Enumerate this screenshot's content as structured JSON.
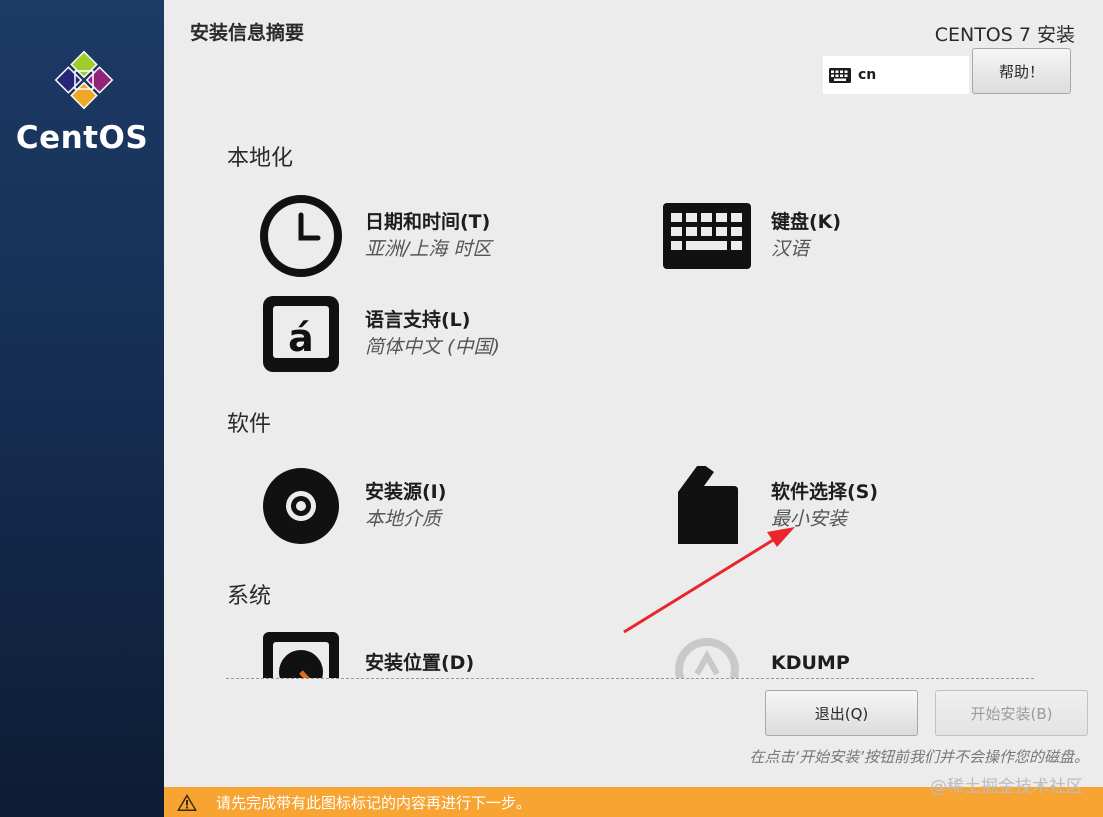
{
  "sidebar": {
    "brand": "CentOS"
  },
  "header": {
    "title": "安装信息摘要",
    "product": "CENTOS 7 安装",
    "keyboard_layout": "cn",
    "help_label": "帮助！"
  },
  "sections": {
    "localization": "本地化",
    "software": "软件",
    "system": "系统"
  },
  "spokes": {
    "datetime": {
      "title": "日期和时间(T)",
      "status": "亚洲/上海 时区",
      "icon": "clock-icon"
    },
    "keyboard": {
      "title": "键盘(K)",
      "status": "汉语",
      "icon": "keyboard-icon"
    },
    "language": {
      "title": "语言支持(L)",
      "status": "简体中文 (中国)",
      "icon": "language-icon"
    },
    "source": {
      "title": "安装源(I)",
      "status": "本地介质",
      "icon": "disc-icon"
    },
    "software_selection": {
      "title": "软件选择(S)",
      "status": "最小安装",
      "icon": "package-icon"
    },
    "destination": {
      "title": "安装位置(D)",
      "icon": "harddisk-icon"
    },
    "kdump": {
      "title": "KDUMP",
      "icon": "kdump-icon"
    }
  },
  "footer": {
    "quit_label": "退出(Q)",
    "begin_label": "开始安装(B)",
    "hint": "在点击‘开始安装’按钮前我们并不会操作您的磁盘。"
  },
  "warning_bar": {
    "text": "请先完成带有此图标标记的内容再进行下一步。",
    "color": "#f7a433"
  },
  "watermark": "@稀土掘金技术社区",
  "colors": {
    "sidebar": "#1d3a66",
    "background": "#ececec",
    "annotation_arrow": "#e8262b"
  }
}
